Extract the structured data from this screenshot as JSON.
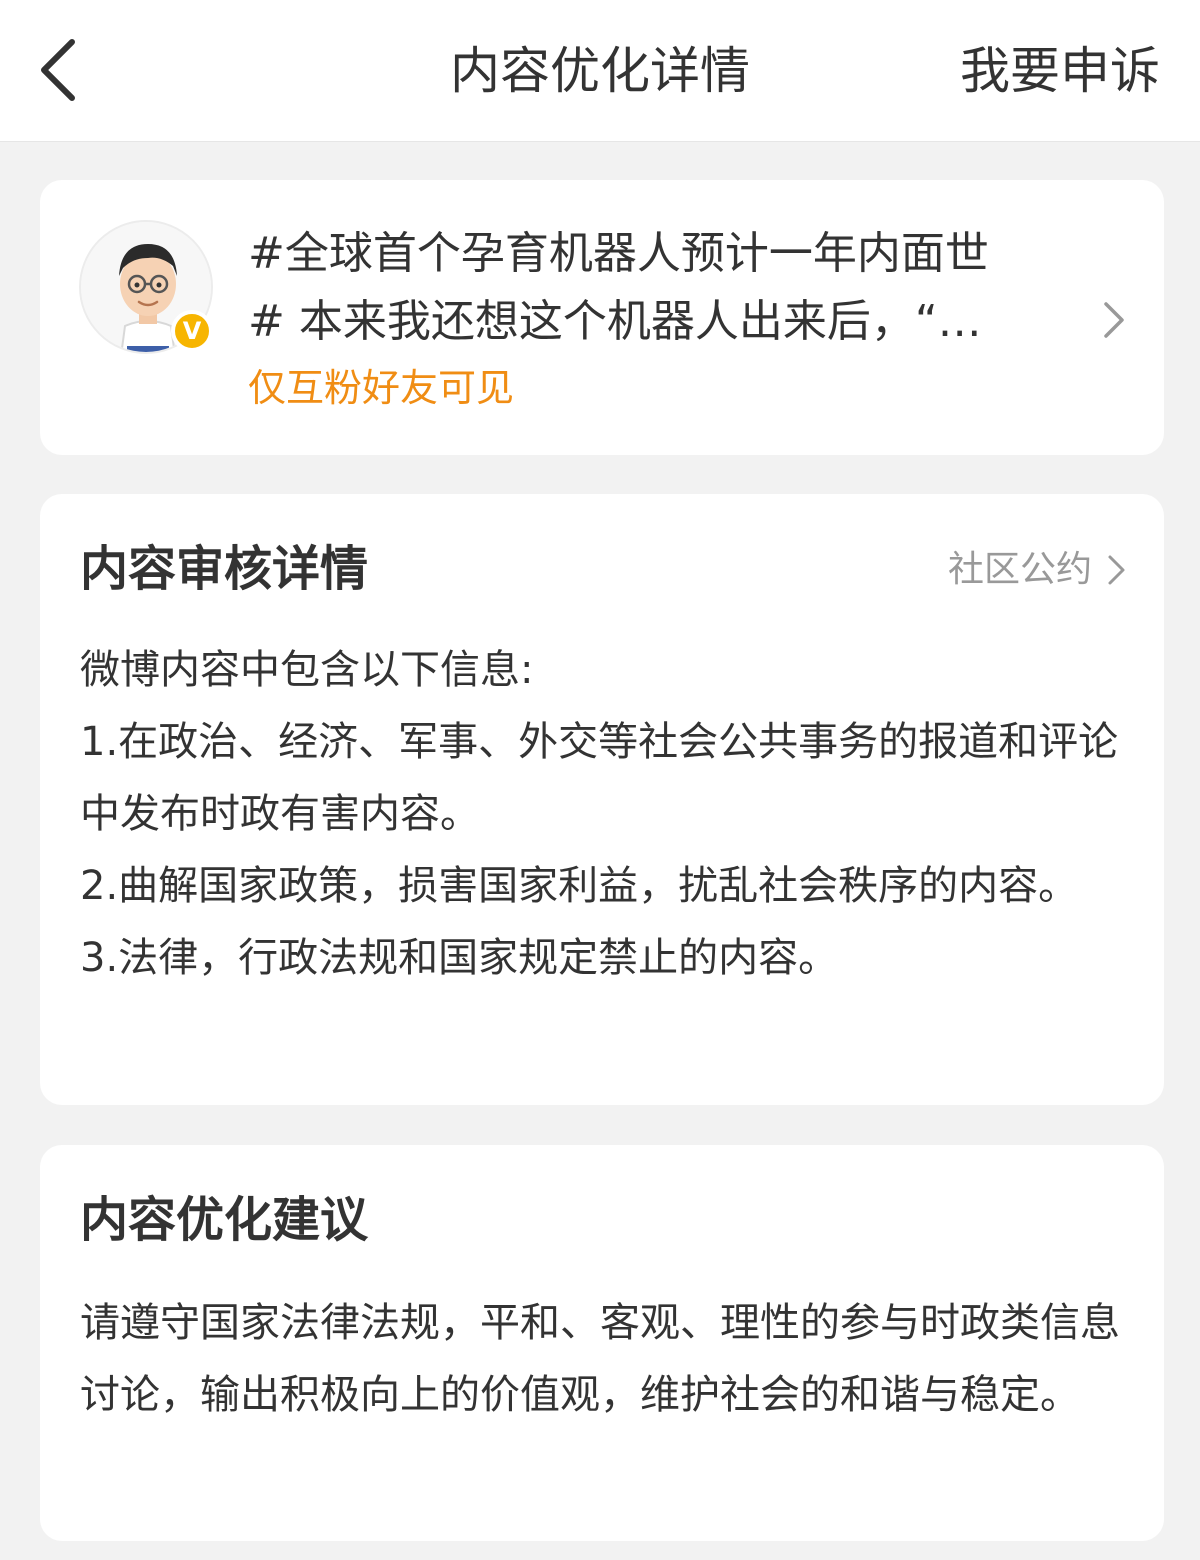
{
  "header": {
    "title": "内容优化详情",
    "appeal_label": "我要申诉"
  },
  "post": {
    "text_line1": "#全球首个孕育机器人预计一年内面世",
    "text_line2": "# 本来我还想这个机器人出来后，“…",
    "visibility": "仅互粉好友可见",
    "verified_badge": "V",
    "verified_badge_color": "#f7b500"
  },
  "review": {
    "title": "内容审核详情",
    "community_link": "社区公约",
    "paragraphs": [
      "微博内容中包含以下信息:",
      "1.在政治、经济、军事、外交等社会公共事务的报道和评论中发布时政有害内容。",
      "2.曲解国家政策，损害国家利益，扰乱社会秩序的内容。",
      "3.法律，行政法规和国家规定禁止的内容。"
    ]
  },
  "suggestion": {
    "title": "内容优化建议",
    "text": "请遵守国家法律法规，平和、客观、理性的参与时政类信息讨论，输出积极向上的价值观，维护社会的和谐与稳定。"
  },
  "colors": {
    "accent_orange": "#f08d14",
    "secondary_text": "#999999",
    "primary_text": "#333333",
    "background": "#f2f2f2"
  },
  "icons": {
    "back": "chevron-left-icon",
    "post_arrow": "chevron-right-icon",
    "community_arrow": "chevron-right-icon",
    "verified": "verified-badge-icon"
  }
}
